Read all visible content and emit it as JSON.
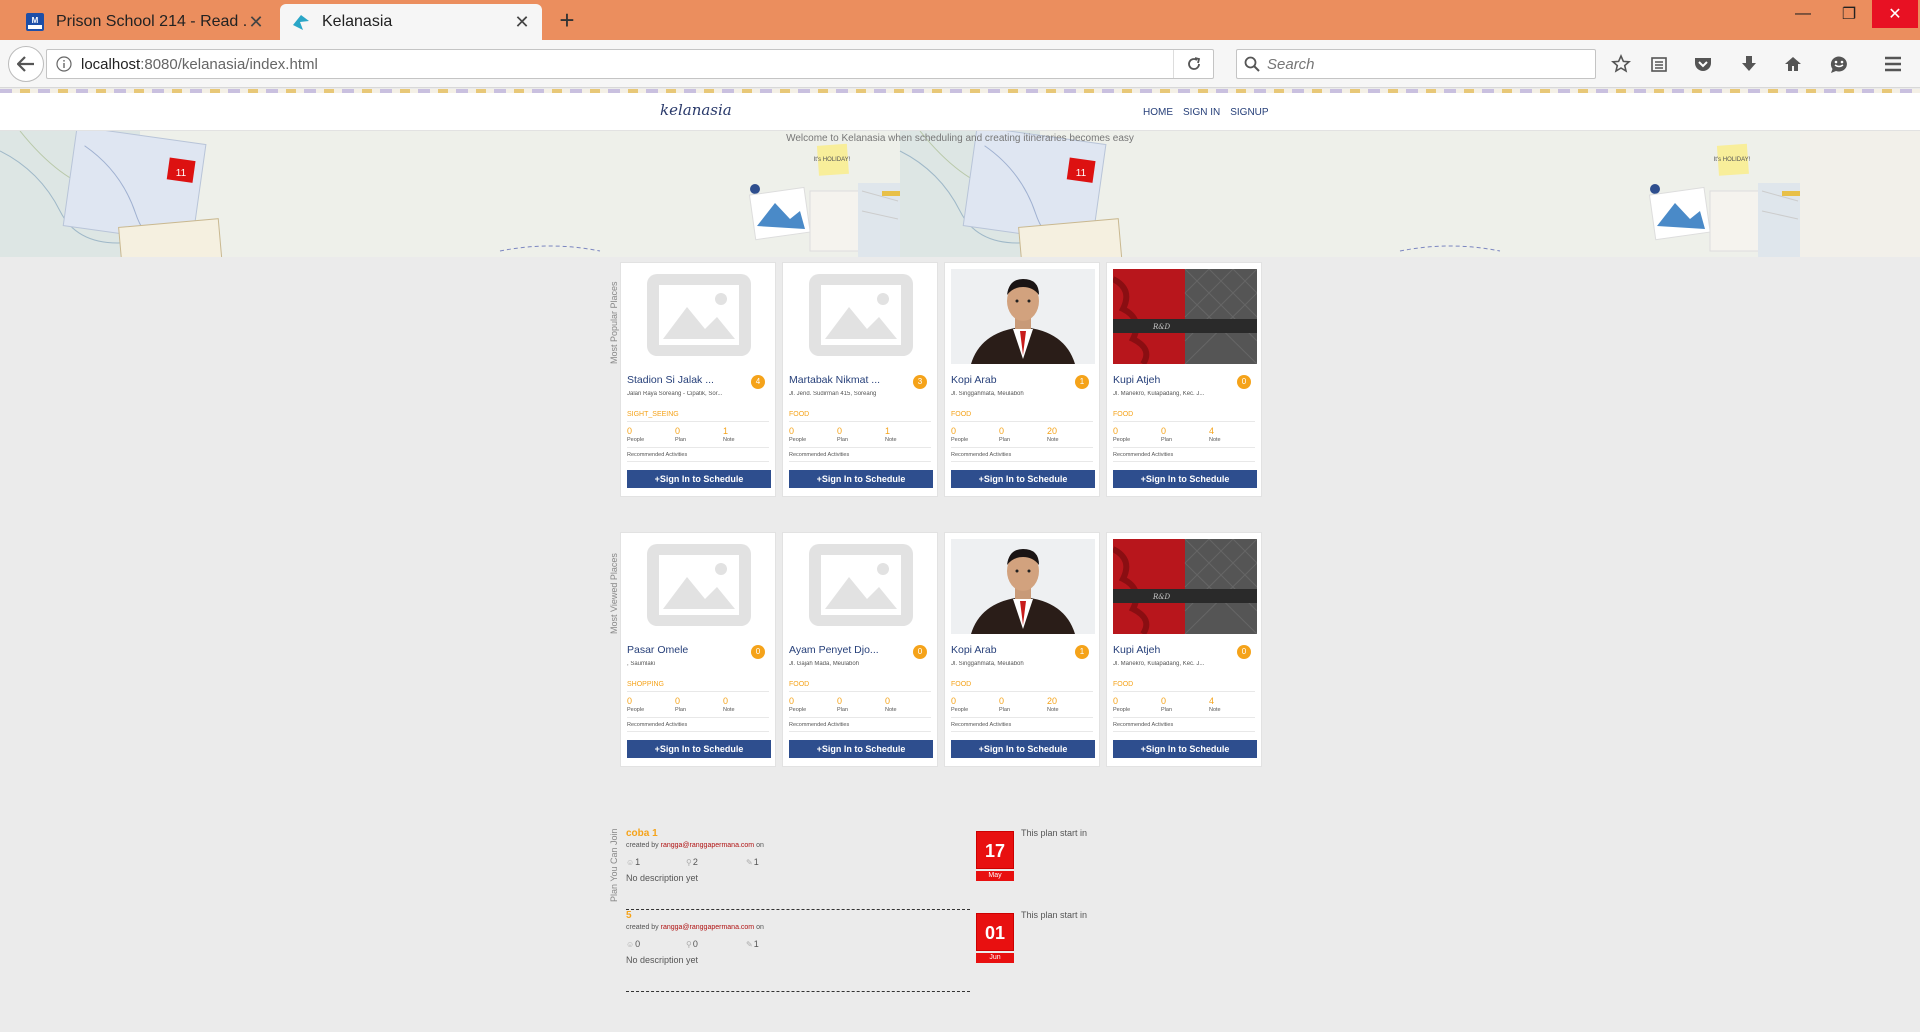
{
  "browser": {
    "tabs": [
      {
        "label": "Prison School 214 - Read ...",
        "active": false
      },
      {
        "label": "Kelanasia",
        "active": true
      }
    ],
    "url_host": "localhost",
    "url_rest": ":8080/kelanasia/index.html",
    "search_placeholder": "Search"
  },
  "site": {
    "logo": "kelanasia",
    "nav": [
      "HOME",
      "SIGN IN",
      "SIGNUP"
    ],
    "welcome": "Welcome to Kelanasia when scheduling and creating itineraries becomes easy",
    "hero_badge": "11",
    "hero_note": "It's HOLIDAY!"
  },
  "popular": {
    "label": "Most Popular Places",
    "cards": [
      {
        "name": "Stadion Si Jalak ...",
        "badge": "4",
        "address": "Jalan Raya Soreang - Cipatik, Sor...",
        "category": "SIGHT_SEEING",
        "people": "0",
        "plan": "0",
        "note": "1",
        "image": "placeholder"
      },
      {
        "name": "Martabak Nikmat ...",
        "badge": "3",
        "address": "Jl. Jend. Sudirman 415, Soreang",
        "category": "FOOD",
        "people": "0",
        "plan": "0",
        "note": "1",
        "image": "placeholder"
      },
      {
        "name": "Kopi Arab",
        "badge": "1",
        "address": "Jl. Singgahmata, Meulaboh",
        "category": "FOOD",
        "people": "0",
        "plan": "0",
        "note": "20",
        "image": "person"
      },
      {
        "name": "Kupi Atjeh",
        "badge": "0",
        "address": "Jl. Manekro, Kulapadang, Kec. J...",
        "category": "FOOD",
        "people": "0",
        "plan": "0",
        "note": "4",
        "image": "banner"
      }
    ]
  },
  "viewed": {
    "label": "Most Viewed Places",
    "cards": [
      {
        "name": "Pasar Omele",
        "badge": "0",
        "address": ", Saumlaki",
        "category": "SHOPPING",
        "people": "0",
        "plan": "0",
        "note": "0",
        "image": "placeholder"
      },
      {
        "name": "Ayam Penyet Djo...",
        "badge": "0",
        "address": "Jl. Gajah Mada, Meulaboh",
        "category": "FOOD",
        "people": "0",
        "plan": "0",
        "note": "0",
        "image": "placeholder"
      },
      {
        "name": "Kopi Arab",
        "badge": "1",
        "address": "Jl. Singgahmata, Meulaboh",
        "category": "FOOD",
        "people": "0",
        "plan": "0",
        "note": "20",
        "image": "person"
      },
      {
        "name": "Kupi Atjeh",
        "badge": "0",
        "address": "Jl. Manekro, Kulapadang, Kec. J...",
        "category": "FOOD",
        "people": "0",
        "plan": "0",
        "note": "4",
        "image": "banner"
      }
    ]
  },
  "card_labels": {
    "people": "People",
    "plan": "Plan",
    "note": "Note",
    "recommended": "Recommended Activities",
    "sign_button": "+Sign In to Schedule"
  },
  "plans": {
    "label": "Plan You Can Join",
    "created_by": "created by",
    "on": "on",
    "start_text": "This plan start in",
    "items": [
      {
        "title": "coba 1",
        "email": "rangga@ranggapermana.com",
        "members": "1",
        "places": "2",
        "notes": "1",
        "description": "No description yet",
        "day": "17",
        "month": "May"
      },
      {
        "title": "5",
        "email": "rangga@ranggapermana.com",
        "members": "0",
        "places": "0",
        "notes": "1",
        "description": "No description yet",
        "day": "01",
        "month": "Jun"
      }
    ]
  },
  "colors": {
    "titlebar": "#eb8e5e",
    "accent_orange": "#f5a31a",
    "button_blue": "#2e4e8e",
    "calendar_red": "#e81010"
  }
}
